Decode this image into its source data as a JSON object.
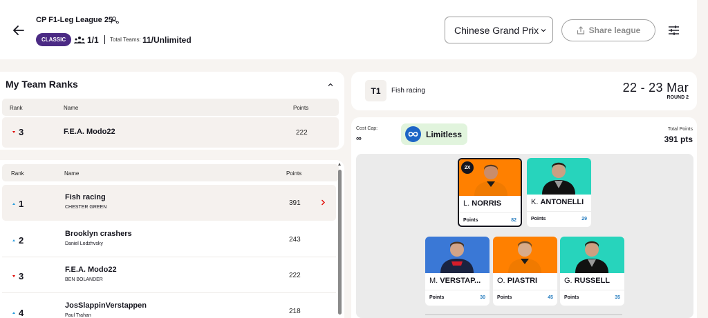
{
  "header": {
    "league_name": "CP F1-Leg League 25",
    "league_type": "CLASSIC",
    "members_count": "1/1",
    "total_teams_label": "Total Teams:",
    "total_teams_value": "11/Unlimited",
    "race_select": "Chinese Grand Prix",
    "share_label": "Share league"
  },
  "my_team_ranks": {
    "title": "My Team Ranks",
    "columns": {
      "rank": "Rank",
      "name": "Name",
      "points": "Points"
    },
    "row": {
      "rank": "3",
      "trend": "down",
      "team": "F.E.A. Modo22",
      "points": "222"
    }
  },
  "standings": {
    "columns": {
      "rank": "Rank",
      "name": "Name",
      "points": "Points"
    },
    "rows": [
      {
        "rank": "1",
        "trend": "up",
        "team": "Fish racing",
        "manager": "CHESTER GREEN",
        "points": "391"
      },
      {
        "rank": "2",
        "trend": "up",
        "team": "Brooklyn crashers",
        "manager": "Daniel Lodzhvsky",
        "points": "243"
      },
      {
        "rank": "3",
        "trend": "down",
        "team": "F.E.A. Modo22",
        "manager": "BEN BOLANDER",
        "points": "222"
      },
      {
        "rank": "4",
        "trend": "up",
        "team": "JosSlappinVerstappen",
        "manager": "Paul Trahan",
        "points": "218"
      }
    ]
  },
  "team_card": {
    "badge": "T1",
    "team": "Fish racing",
    "dates": "22 - 23 Mar",
    "round": "ROUND 2"
  },
  "team_panel": {
    "cost_cap_label": "Cost Cap:",
    "cost_cap_value": "∞",
    "chip_label": "Limitless",
    "total_points_label": "Total Points",
    "total_points_value": "391 pts",
    "drivers": [
      {
        "initial": "L.",
        "surname": "NORRIS",
        "points_label": "Points",
        "points": "82",
        "captain_badge": "2X",
        "bg": "#ff8000"
      },
      {
        "initial": "K.",
        "surname": "ANTONELLI",
        "points_label": "Points",
        "points": "29",
        "bg": "#27d4bc"
      },
      {
        "initial": "M.",
        "surname": "VERSTAP...",
        "points_label": "Points",
        "points": "30",
        "bg": "#3a78d6"
      },
      {
        "initial": "O.",
        "surname": "PIASTRI",
        "points_label": "Points",
        "points": "45",
        "bg": "#ff8000"
      },
      {
        "initial": "G.",
        "surname": "RUSSELL",
        "points_label": "Points",
        "points": "35",
        "bg": "#27d4bc"
      }
    ]
  }
}
